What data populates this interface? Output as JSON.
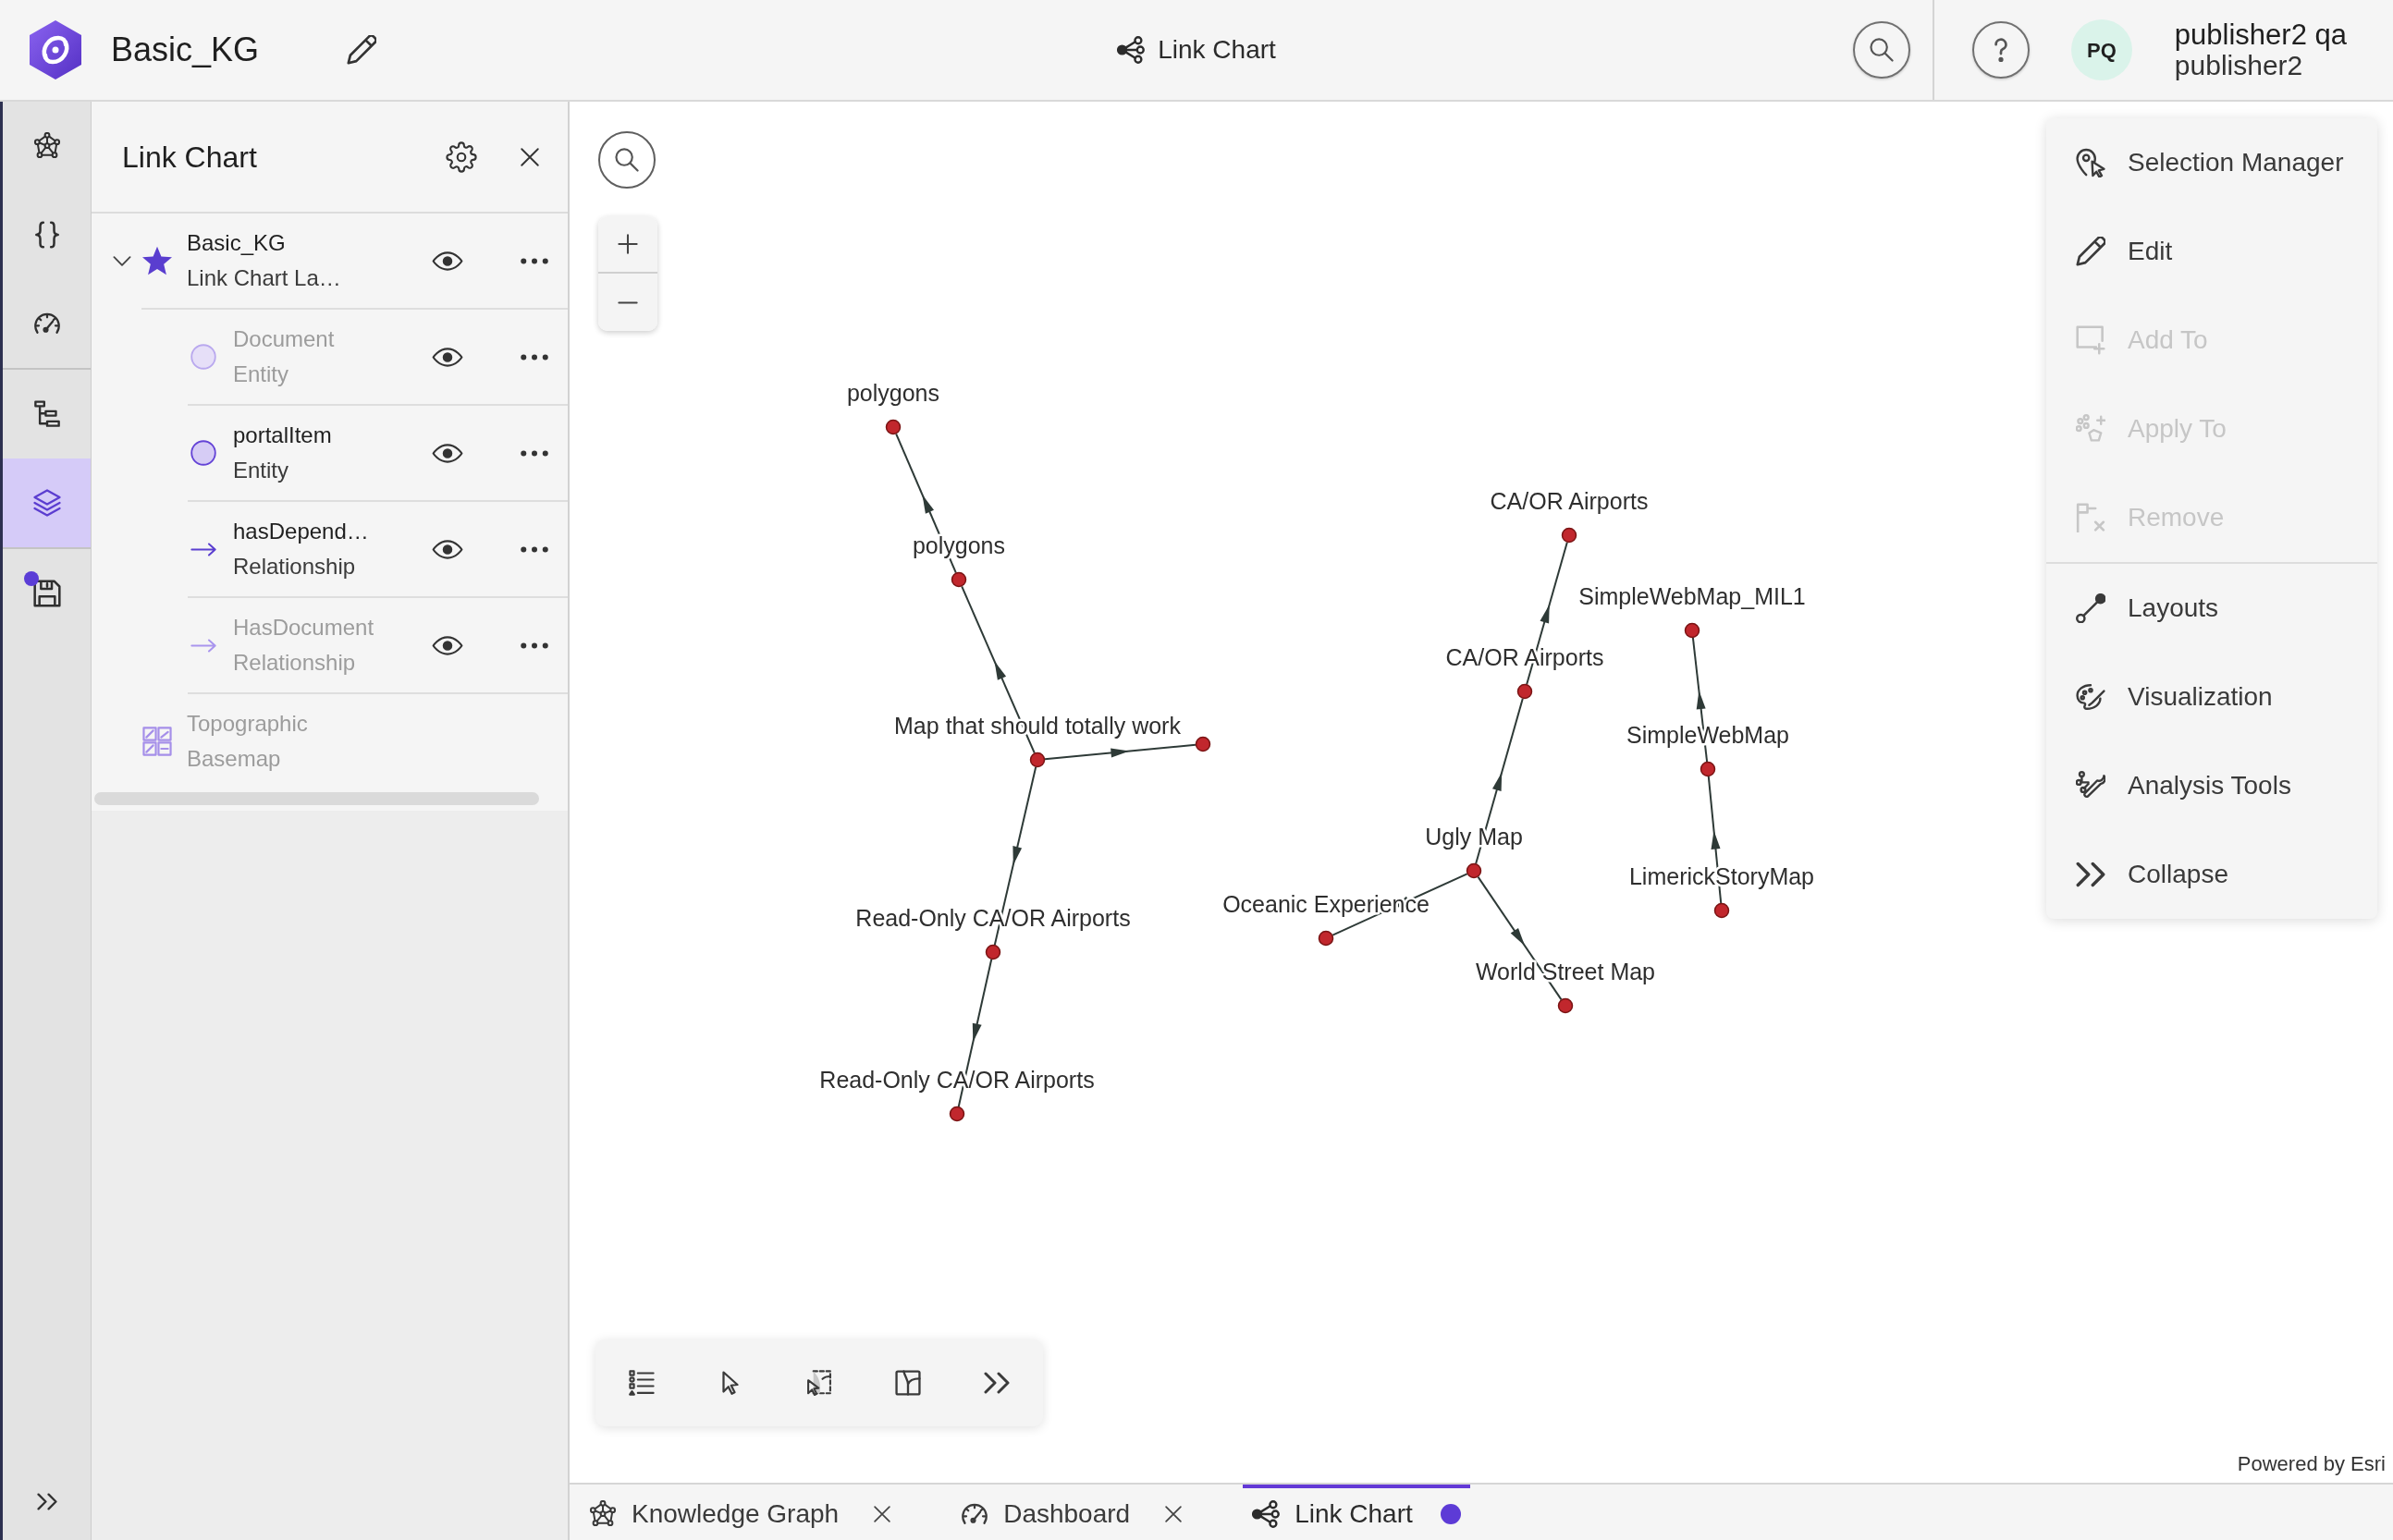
{
  "header": {
    "title": "Basic_KG",
    "view_title": "Link Chart",
    "user": {
      "initials": "PQ",
      "full_name": "publisher2 qa",
      "username": "publisher2"
    }
  },
  "sidebar": {
    "groups": [
      {
        "items": [
          {
            "selected": false,
            "dot": false
          },
          {
            "selected": false,
            "dot": false
          },
          {
            "selected": false,
            "dot": false
          }
        ]
      },
      {
        "items": [
          {
            "selected": false,
            "dot": false
          },
          {
            "selected": true,
            "dot": false
          }
        ]
      },
      {
        "items": [
          {
            "selected": false,
            "dot": true
          }
        ]
      }
    ]
  },
  "panel": {
    "title": "Link Chart",
    "layers": [
      {
        "kind": "link_chart",
        "title": "Basic_KG",
        "subtitle": "Link Chart La…",
        "expanded": true,
        "dimmed": false,
        "children": [
          {
            "kind": "entity",
            "title": "Document",
            "subtitle": "Entity",
            "dimmed": true
          },
          {
            "kind": "entity",
            "title": "portalItem",
            "subtitle": "Entity",
            "dimmed": false
          },
          {
            "kind": "relationship",
            "title": "hasDepend…",
            "subtitle": "Relationship",
            "dimmed": false
          },
          {
            "kind": "relationship",
            "title": "HasDocument",
            "subtitle": "Relationship",
            "dimmed": true
          }
        ]
      },
      {
        "kind": "basemap",
        "title": "Topographic",
        "subtitle": "Basemap",
        "dimmed": true
      }
    ]
  },
  "map": {
    "link_chart": {
      "nodes": [
        {
          "label": "Map that should totally work",
          "selected": false,
          "children": [
            {
              "label": "polygons",
              "selected": false,
              "children": [
                {
                  "label": "polygons",
                  "selected": false
                }
              ]
            },
            {
              "selected": false
            },
            {
              "label": "Read-Only CA/OR Airports",
              "selected": false,
              "children": [
                {
                  "label": "Read-Only CA/OR Airports",
                  "selected": false
                }
              ]
            }
          ]
        },
        {
          "label": "Ugly Map",
          "selected": false,
          "children": [
            {
              "label": "CA/OR Airports",
              "selected": false,
              "children": [
                {
                  "label": "CA/OR Airports",
                  "selected": false
                }
              ]
            },
            {
              "label": "Oceanic Experience",
              "selected": false
            },
            {
              "label": "World Street Map",
              "selected": false
            }
          ]
        },
        {
          "label": "LimerickStoryMap",
          "selected": false,
          "children": [
            {
              "label": "SimpleWebMap",
              "selected": false,
              "children": [
                {
                  "label": "SimpleWebMap_MIL1",
                  "selected": false
                }
              ]
            }
          ]
        }
      ]
    },
    "menu": {
      "groups": [
        {
          "items": [
            {
              "label": "Selection Manager",
              "disabled": false
            },
            {
              "label": "Edit",
              "disabled": false
            },
            {
              "label": "Add To",
              "disabled": true
            },
            {
              "label": "Apply To",
              "disabled": true
            },
            {
              "label": "Remove",
              "disabled": true
            }
          ]
        },
        {
          "items": [
            {
              "label": "Layouts",
              "disabled": false
            },
            {
              "label": "Visualization",
              "disabled": false
            },
            {
              "label": "Analysis Tools",
              "disabled": false
            },
            {
              "label": "Collapse",
              "disabled": false
            }
          ]
        }
      ]
    },
    "credit": "Powered by Esri"
  },
  "tabs": [
    {
      "label": "Knowledge Graph",
      "selected": false,
      "modified": false
    },
    {
      "label": "Dashboard",
      "selected": false,
      "modified": false
    },
    {
      "label": "Link Chart",
      "selected": true,
      "modified": true
    }
  ]
}
